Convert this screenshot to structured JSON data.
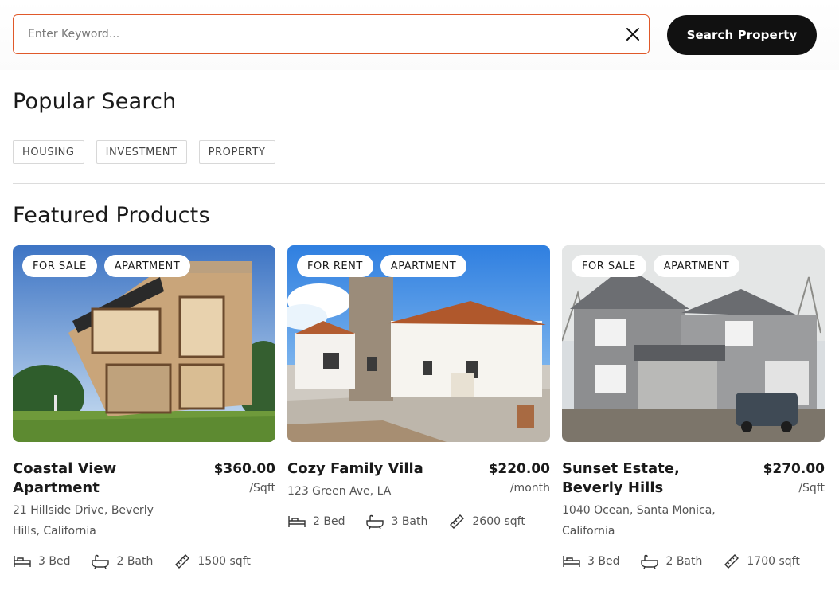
{
  "search": {
    "placeholder": "Enter Keyword...",
    "button_label": "Search Property"
  },
  "popular": {
    "title": "Popular Search",
    "tags": [
      "HOUSING",
      "INVESTMENT",
      "PROPERTY"
    ]
  },
  "featured": {
    "title": "Featured Products",
    "cards": [
      {
        "badges": [
          "FOR SALE",
          "APARTMENT"
        ],
        "title": "Coastal View Apartment",
        "price": "$360.00",
        "unit": "/Sqft",
        "address": "21 Hillside Drive, Beverly Hills, California",
        "beds": "3 Bed",
        "baths": "2 Bath",
        "area": "1500 sqft"
      },
      {
        "badges": [
          "FOR RENT",
          "APARTMENT"
        ],
        "title": "Cozy Family Villa",
        "price": "$220.00",
        "unit": "/month",
        "address": "123 Green Ave, LA",
        "beds": "2 Bed",
        "baths": "3 Bath",
        "area": "2600 sqft"
      },
      {
        "badges": [
          "FOR SALE",
          "APARTMENT"
        ],
        "title": "Sunset Estate, Beverly Hills",
        "price": "$270.00",
        "unit": "/Sqft",
        "address": "1040 Ocean, Santa Monica, California",
        "beds": "3 Bed",
        "baths": "2 Bath",
        "area": "1700 sqft"
      }
    ]
  },
  "icons": {
    "clear": "close-icon",
    "bed": "bed-icon",
    "bath": "bathtub-icon",
    "area": "ruler-icon"
  },
  "colors": {
    "accent_border": "#e0592a",
    "button_bg": "#111111"
  }
}
